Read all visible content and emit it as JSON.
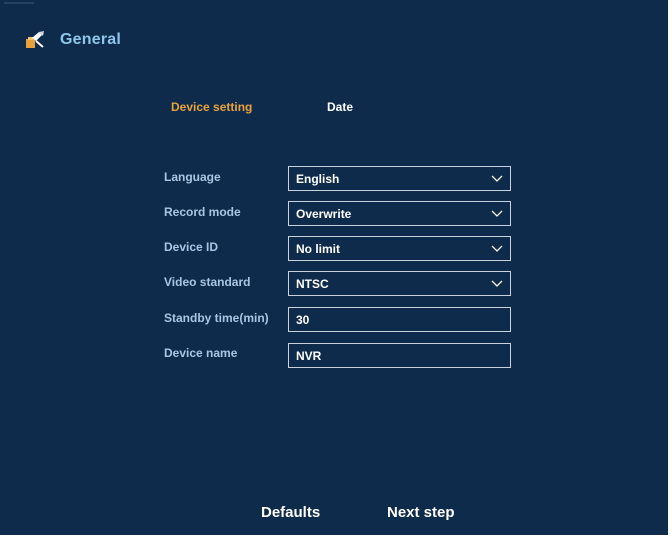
{
  "header": {
    "title": "General",
    "icon": "general-settings-icon"
  },
  "tabs": [
    {
      "label": "Device setting",
      "active": true
    },
    {
      "label": "Date",
      "active": false
    }
  ],
  "form": {
    "language": {
      "label": "Language",
      "value": "English"
    },
    "record_mode": {
      "label": "Record mode",
      "value": "Overwrite"
    },
    "device_id": {
      "label": "Device ID",
      "value": "No limit"
    },
    "video_standard": {
      "label": "Video standard",
      "value": "NTSC"
    },
    "standby_time": {
      "label": "Standby time(min)",
      "value": "30"
    },
    "device_name": {
      "label": "Device name",
      "value": "NVR"
    }
  },
  "footer": {
    "defaults_label": "Defaults",
    "next_label": "Next step"
  },
  "colors": {
    "background": "#0f2b4c",
    "active_tab": "#e8a23c",
    "title": "#8fc6ea",
    "label": "#a8c6e2"
  }
}
